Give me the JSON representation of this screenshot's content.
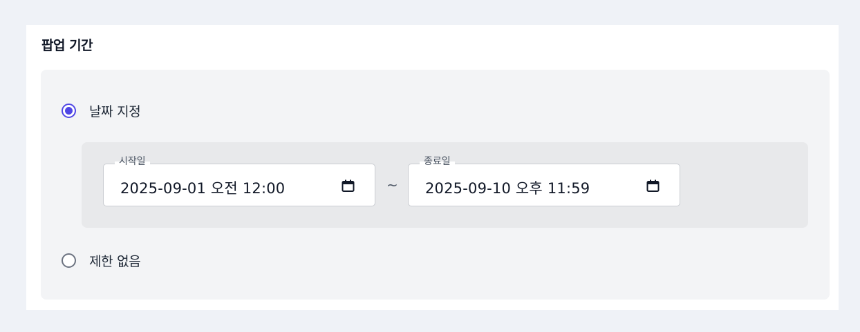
{
  "section": {
    "title": "팝업 기간"
  },
  "options": {
    "specify": {
      "label": "날짜 지정",
      "checked": true
    },
    "unlimited": {
      "label": "제한 없음",
      "checked": false
    }
  },
  "date_range": {
    "start": {
      "label": "시작일",
      "value": "2025-09-01 오전 12:00",
      "icon": "calendar-icon"
    },
    "separator": "~",
    "end": {
      "label": "종료일",
      "value": "2025-09-10 오후 11:59",
      "icon": "calendar-icon"
    }
  },
  "colors": {
    "accent": "#4f46e5",
    "page_background": "#eff2f7",
    "panel_background": "#f3f4f6"
  }
}
